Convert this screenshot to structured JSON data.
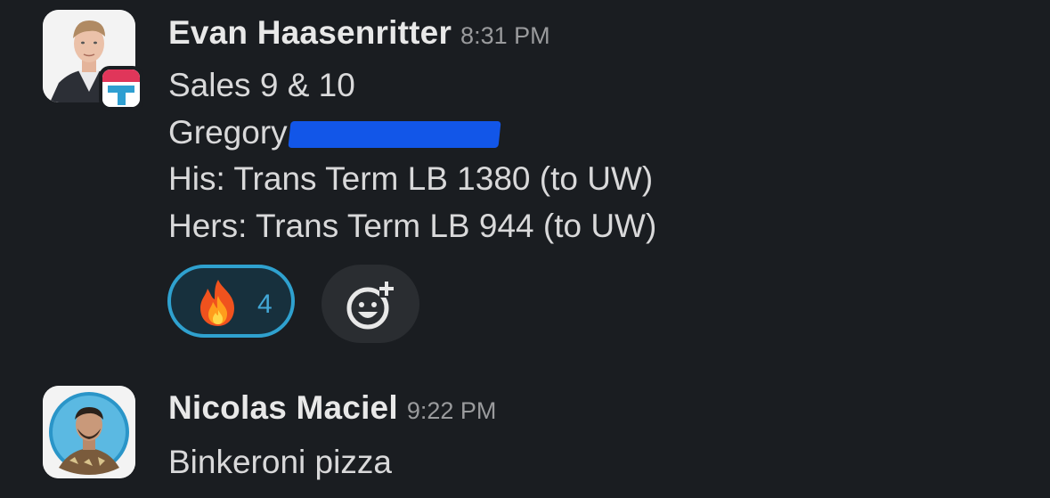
{
  "messages": [
    {
      "author": "Evan Haasenritter",
      "time": "8:31 PM",
      "lines": [
        "Sales 9 & 10",
        "Gregory",
        "His: Trans Term LB 1380 (to UW)",
        "Hers: Trans Term LB 944 (to UW)"
      ],
      "avatar_icon": "user-avatar-photo",
      "app_badge_icon": "app-badge-icon",
      "reactions": [
        {
          "emoji": "🔥",
          "emoji_name": "fire-emoji",
          "count": "4"
        }
      ],
      "add_reaction_icon": "add-reaction-icon"
    },
    {
      "author": "Nicolas Maciel",
      "time": "9:22 PM",
      "lines": [
        "Binkeroni pizza"
      ],
      "avatar_icon": "user-avatar-photo"
    }
  ],
  "colors": {
    "background": "#1a1d21",
    "reaction_border": "#2fa1cf",
    "reaction_bg": "#17303d",
    "redaction": "#1256e8"
  }
}
